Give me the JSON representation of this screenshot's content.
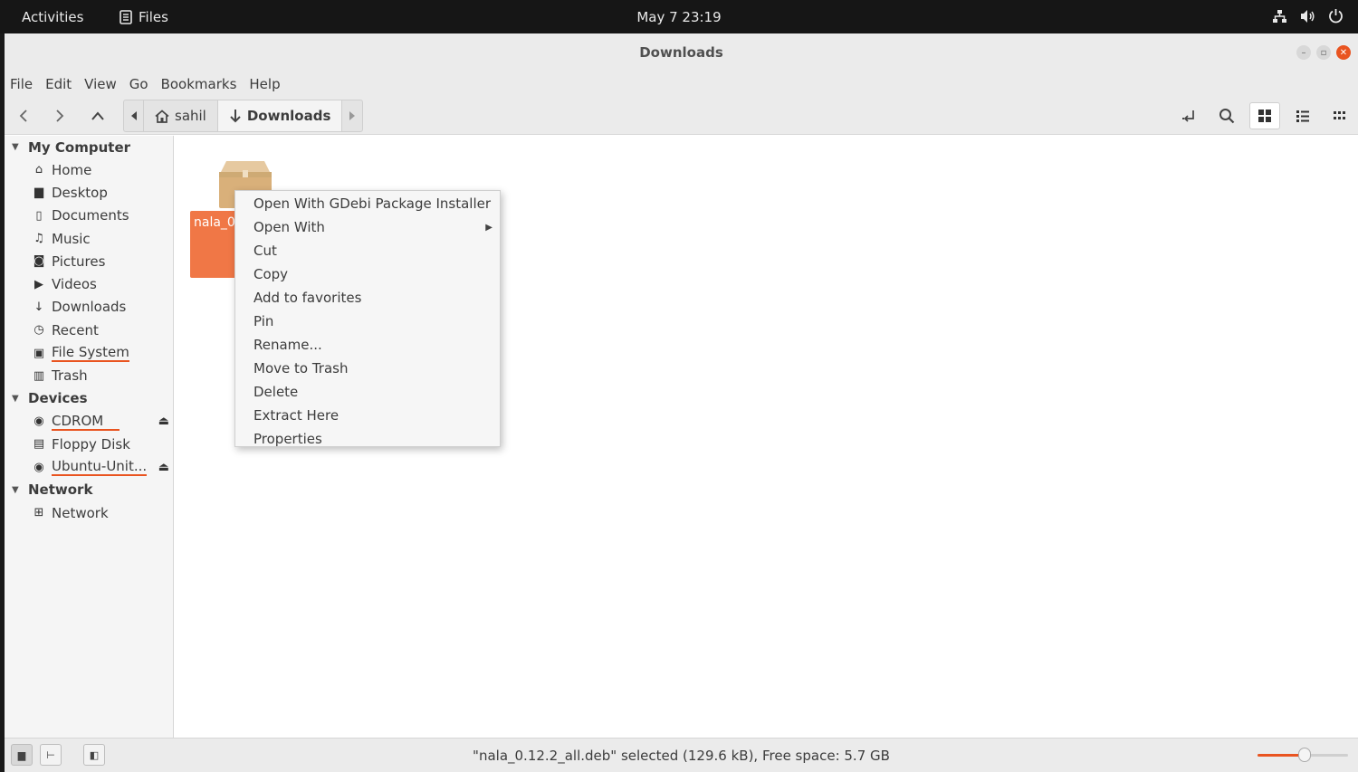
{
  "topbar": {
    "activities": "Activities",
    "app_name": "Files",
    "clock": "May 7  23:19"
  },
  "window": {
    "title": "Downloads"
  },
  "menubar": [
    "File",
    "Edit",
    "View",
    "Go",
    "Bookmarks",
    "Help"
  ],
  "breadcrumb": {
    "home": "sahil",
    "current": "Downloads"
  },
  "sidebar": {
    "sections": [
      {
        "title": "My Computer",
        "items": [
          {
            "label": "Home",
            "icon": "home-icon"
          },
          {
            "label": "Desktop",
            "icon": "folder-icon"
          },
          {
            "label": "Documents",
            "icon": "document-icon"
          },
          {
            "label": "Music",
            "icon": "music-icon"
          },
          {
            "label": "Pictures",
            "icon": "camera-icon"
          },
          {
            "label": "Videos",
            "icon": "video-icon"
          },
          {
            "label": "Downloads",
            "icon": "download-icon"
          },
          {
            "label": "Recent",
            "icon": "clock-icon"
          },
          {
            "label": "File System",
            "icon": "drive-icon"
          },
          {
            "label": "Trash",
            "icon": "trash-icon"
          }
        ]
      },
      {
        "title": "Devices",
        "items": [
          {
            "label": "CDROM",
            "icon": "disc-icon"
          },
          {
            "label": "Floppy Disk",
            "icon": "floppy-icon"
          },
          {
            "label": "Ubuntu-Unit...",
            "icon": "disc-icon"
          }
        ]
      },
      {
        "title": "Network",
        "items": [
          {
            "label": "Network",
            "icon": "network-icon"
          }
        ]
      }
    ]
  },
  "file": {
    "name": "nala_0"
  },
  "context_menu": [
    "Open With GDebi Package Installer",
    "Open With",
    "Cut",
    "Copy",
    "Add to favorites",
    "Pin",
    "Rename...",
    "Move to Trash",
    "Delete",
    "Extract Here",
    "Properties"
  ],
  "status": {
    "text": "\"nala_0.12.2_all.deb\" selected (129.6 kB), Free space: 5.7 GB",
    "zoom_fraction": 0.52
  },
  "colors": {
    "accent": "#e95420",
    "selection": "#f07746"
  }
}
